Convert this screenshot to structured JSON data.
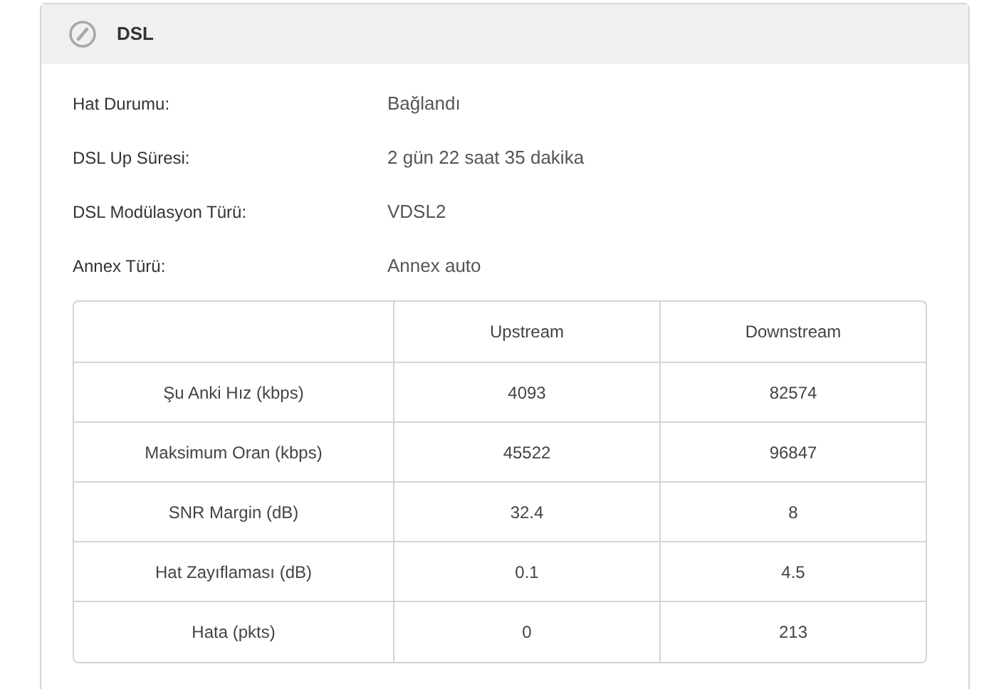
{
  "panel": {
    "title": "DSL"
  },
  "info": [
    {
      "label": "Hat Durumu:",
      "value": "Bağlandı"
    },
    {
      "label": "DSL Up Süresi:",
      "value": "2 gün 22 saat 35 dakika"
    },
    {
      "label": "DSL Modülasyon Türü:",
      "value": "VDSL2"
    },
    {
      "label": "Annex Türü:",
      "value": "Annex auto"
    }
  ],
  "table": {
    "columns": [
      "Upstream",
      "Downstream"
    ],
    "rows": [
      {
        "label": "Şu Anki Hız (kbps)",
        "upstream": "4093",
        "downstream": "82574"
      },
      {
        "label": "Maksimum Oran (kbps)",
        "upstream": "45522",
        "downstream": "96847"
      },
      {
        "label": "SNR Margin (dB)",
        "upstream": "32.4",
        "downstream": "8"
      },
      {
        "label": "Hat Zayıflaması (dB)",
        "upstream": "0.1",
        "downstream": "4.5"
      },
      {
        "label": "Hata (pkts)",
        "upstream": "0",
        "downstream": "213"
      }
    ]
  }
}
